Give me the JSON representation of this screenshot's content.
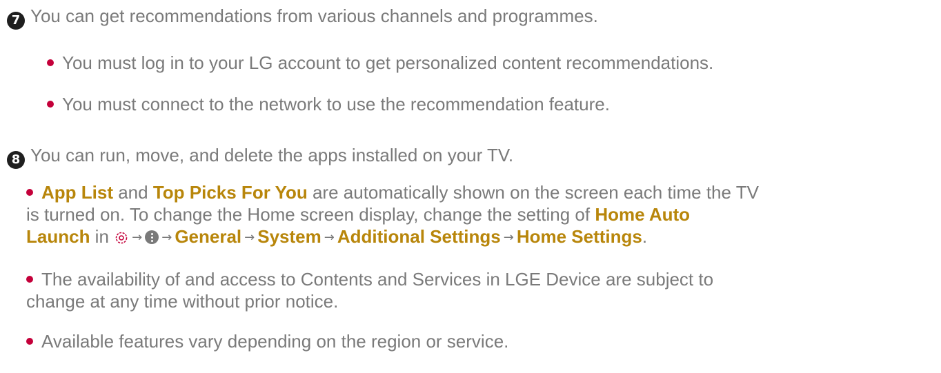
{
  "colors": {
    "highlight": "#b8860b",
    "bullet": "#c4003a",
    "text": "#7a7a7a"
  },
  "step7": {
    "badge": "7",
    "text": "You can get recommendations from various channels and programmes.",
    "bullets": [
      "You must log in to your LG account to get personalized content recommendations.",
      "You must connect to the network to use the recommendation feature."
    ]
  },
  "step8": {
    "badge": "8",
    "text": "You can run, move, and delete the apps installed on your TV."
  },
  "notes": {
    "note1": {
      "app_list": "App List",
      "and": " and ",
      "top_picks": "Top Picks For You",
      "rest1": " are automatically shown on the screen each time the TV",
      "line2": "is turned on. To change the Home screen display, change the setting of ",
      "home_auto": "Home Auto",
      "launch": "Launch",
      "in": " in ",
      "settings_icon": "gear-icon",
      "more_icon": "more-options-icon",
      "path": [
        "General",
        "System",
        "Additional Settings",
        "Home Settings"
      ],
      "arrow": "→",
      "period": "."
    },
    "note2": [
      "The availability of and access to Contents and Services in LGE Device are subject to",
      "change at any time without prior notice."
    ],
    "note3": "Available features vary depending on the region or service."
  }
}
